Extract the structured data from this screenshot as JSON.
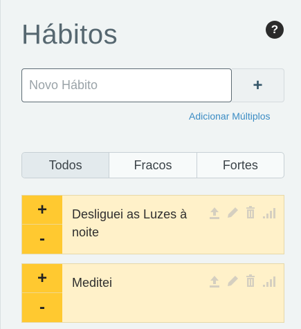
{
  "header": {
    "title": "Hábitos",
    "help_icon": "question-circle-icon"
  },
  "add_habit": {
    "placeholder": "Novo Hábito",
    "add_button": "+",
    "add_multiple": "Adicionar Múltiplos"
  },
  "filters": {
    "tabs": [
      {
        "label": "Todos"
      },
      {
        "label": "Fracos"
      },
      {
        "label": "Fortes"
      }
    ],
    "active": "Todos"
  },
  "habits": [
    {
      "text": "Desliguei as Luzes à noite",
      "plus": "+",
      "minus": "-"
    },
    {
      "text": "Meditei",
      "plus": "+",
      "minus": "-"
    }
  ],
  "colors": {
    "habit_bg": "#fff1c9",
    "control_yellow": "#ffc930",
    "link_blue": "#3b8cc4",
    "title": "#566770"
  }
}
